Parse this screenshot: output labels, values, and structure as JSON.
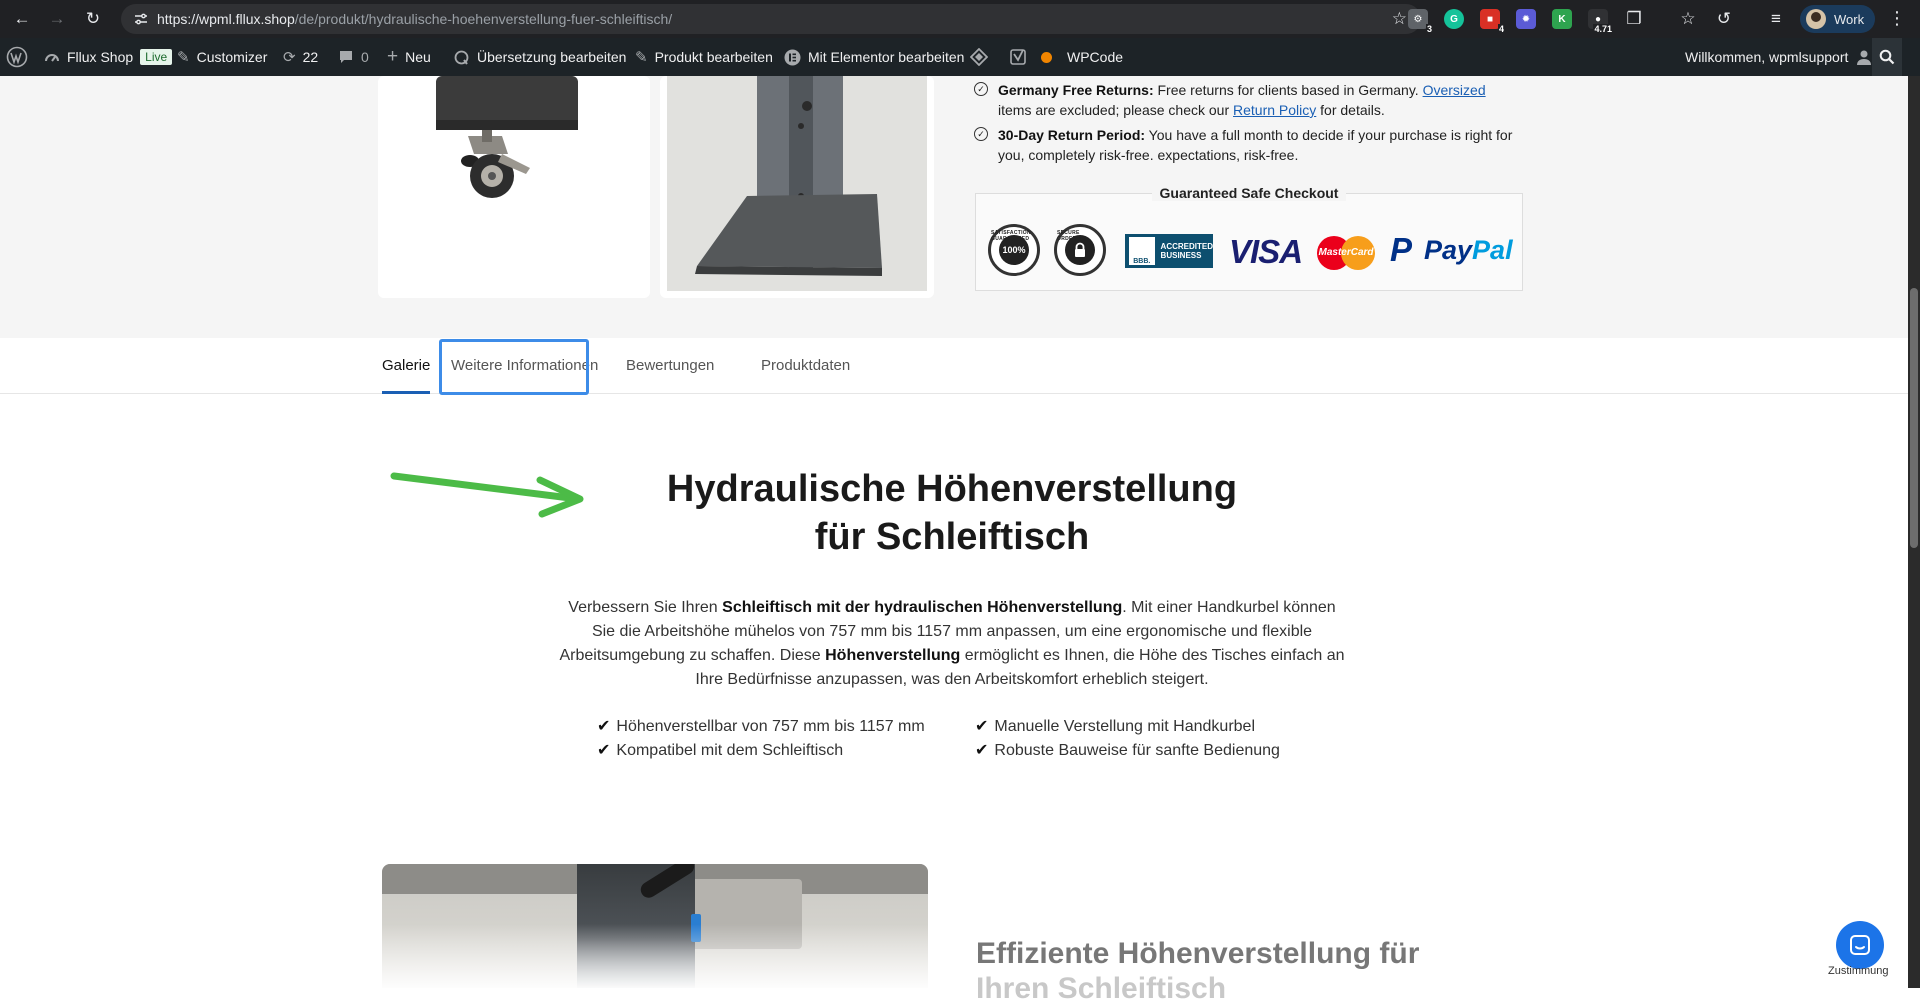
{
  "browser": {
    "url_host": "https://wpml.fllux.shop",
    "url_path": "/de/produkt/hydraulische-hoehenverstellung-fuer-schleiftisch/",
    "extensions": [
      {
        "name": "extension-1",
        "badge": "3",
        "color": "#5f6368"
      },
      {
        "name": "grammarly",
        "badge": "",
        "color": "#15c39a"
      },
      {
        "name": "extension-red",
        "badge": "4",
        "color": "#d93025"
      },
      {
        "name": "extension-purple",
        "badge": "",
        "color": "#5b5bd6"
      },
      {
        "name": "extension-green-k",
        "badge": "",
        "color": "#2ea44f"
      },
      {
        "name": "extension-score",
        "badge": "4.71",
        "color": "#303134"
      }
    ],
    "profile_name": "Work"
  },
  "adminbar": {
    "site_name": "Fllux Shop",
    "live_badge": "Live",
    "customizer": "Customizer",
    "updates_count": "22",
    "comments_count": "0",
    "new_label": "Neu",
    "translate_label": "Übersetzung bearbeiten",
    "edit_product_label": "Produkt bearbeiten",
    "elementor_label": "Mit Elementor bearbeiten",
    "wpcode_label": "WPCode",
    "welcome_label": "Willkommen, wpmlsupport"
  },
  "product_info": {
    "returns_title": "Germany Free Returns:",
    "returns_text_1": " Free returns for clients based in Germany. ",
    "returns_link_oversized": "Oversized",
    "returns_text_2": "items are excluded; please check our ",
    "returns_link_policy": "Return Policy",
    "returns_text_3": " for details.",
    "period_title": "30-Day Return Period:",
    "period_text": " You have a full month to decide if your purchase is right for you, completely risk-free. expectations, risk-free.",
    "checkout_title": "Guaranteed Safe Checkout",
    "badges": {
      "satisfaction_inner": "100%",
      "satisfaction_ring": "SATISFACTION GUARANTEED",
      "secure_ring": "SECURE ORDERING",
      "bbb_logo": "BBB.",
      "bbb_label_1": "ACCREDITED",
      "bbb_label_2": "BUSINESS",
      "visa": "VISA",
      "mastercard": "MasterCard",
      "paypal_p": "P",
      "paypal_pay": "Pay",
      "paypal_pal": "Pal"
    }
  },
  "tabs": [
    {
      "label": "Galerie",
      "active": true
    },
    {
      "label": "Weitere Informationen",
      "active": false
    },
    {
      "label": "Bewertungen",
      "active": false
    },
    {
      "label": "Produktdaten",
      "active": false
    }
  ],
  "content": {
    "headline_line1": "Hydraulische Höhenverstellung",
    "headline_line2": "für Schleiftisch",
    "desc": {
      "p1": "Verbessern Sie Ihren ",
      "b1": "Schleiftisch mit der hydraulischen Höhenverstellung",
      "p2": ". Mit einer Handkurbel können Sie die Arbeitshöhe mühelos von 757 mm bis 1157 mm anpassen, um eine ergonomische und flexible Arbeitsumgebung zu schaffen. Diese ",
      "b2": "Höhenverstellung",
      "p3": " ermöglicht es Ihnen, die Höhe des Tisches einfach an Ihre Bedürfnisse anzupassen, was den Arbeitskomfort erheblich steigert."
    },
    "features": [
      "Höhenverstellbar von 757 mm bis 1157 mm",
      "Manuelle Verstellung mit Handkurbel",
      "Kompatibel mit dem Schleiftisch",
      "Robuste Bauweise für sanfte Bedienung"
    ],
    "subheadline": "Effiziente Höhenverstellung für",
    "subheadline_2": "Ihren Schleiftisch"
  },
  "chat": {
    "label": "Zustimmung"
  },
  "colors": {
    "accent": "#1a5fb4",
    "focus": "#3d8ce8",
    "arrow": "#4cbb47"
  }
}
